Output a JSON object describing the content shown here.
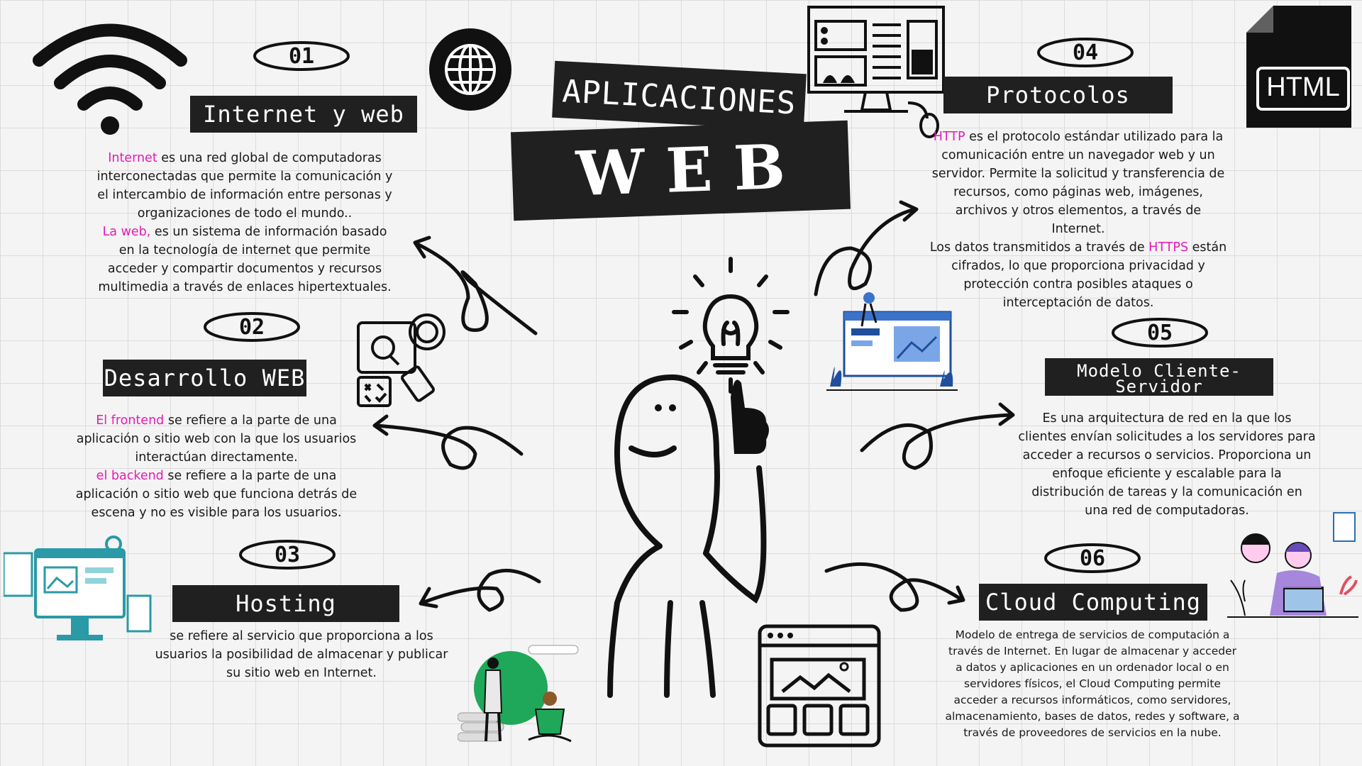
{
  "title": {
    "line1": "APLICACIONES",
    "line2": "W E B"
  },
  "badge": {
    "html": "HTML"
  },
  "sections": [
    {
      "number": "01",
      "heading": "Internet y web",
      "p1_highlight": "Internet",
      "p1_rest": " es una red global de computadoras interconectadas que permite la comunicación y el intercambio de información entre personas y organizaciones de todo el mundo..",
      "p2_highlight": "La web,",
      "p2_rest": " es un sistema de información basado en la tecnología de internet que permite acceder y compartir documentos y recursos multimedia a través de enlaces hipertextuales."
    },
    {
      "number": "02",
      "heading": "Desarrollo WEB",
      "p1_highlight": "El frontend",
      "p1_rest": " se refiere a la parte de una aplicación o sitio web con la que los usuarios interactúan directamente.",
      "p2_highlight": "el backend",
      "p2_rest": " se refiere a la parte de una aplicación o sitio web que funciona detrás de escena y no es visible para los usuarios."
    },
    {
      "number": "03",
      "heading": "Hosting",
      "p1_rest": "se refiere al servicio que proporciona a los usuarios la posibilidad de almacenar y publicar su sitio web en Internet."
    },
    {
      "number": "04",
      "heading": "Protocolos",
      "p1_highlight": "HTTP",
      "p1_rest": " es el protocolo estándar utilizado para la comunicación entre un navegador web y un servidor. Permite la solicitud y transferencia de recursos, como páginas web, imágenes, archivos y otros elementos, a través de Internet.",
      "p2_pre": "Los datos transmitidos a través de ",
      "p2_highlight": "HTTPS",
      "p2_rest": " están cifrados, lo que proporciona privacidad y protección contra posibles ataques o interceptación de datos."
    },
    {
      "number": "05",
      "heading_line1": "Modelo Cliente-",
      "heading_line2": "Servidor",
      "p1_rest": "Es una arquitectura de red en la que los clientes envían solicitudes a los servidores para acceder a recursos o servicios. Proporciona un enfoque eficiente y escalable para la distribución de tareas y la comunicación en una red de computadoras."
    },
    {
      "number": "06",
      "heading": "Cloud Computing",
      "p1_rest": "Modelo de entrega de servicios de computación a través de Internet. En lugar de almacenar y acceder a datos y aplicaciones en un ordenador local o en servidores físicos, el Cloud Computing permite acceder a recursos informáticos, como servidores, almacenamiento, bases de datos, redes y software, a través de proveedores de servicios en la nube."
    }
  ],
  "colors": {
    "highlight": "#e41bb4",
    "label_bg": "#202020",
    "background": "#f4f4f4"
  },
  "icons": [
    "wifi-icon",
    "globe-icon",
    "computer-icon",
    "html-file-icon",
    "lightbulb-icon",
    "stick-figure",
    "browser-window-icon"
  ]
}
